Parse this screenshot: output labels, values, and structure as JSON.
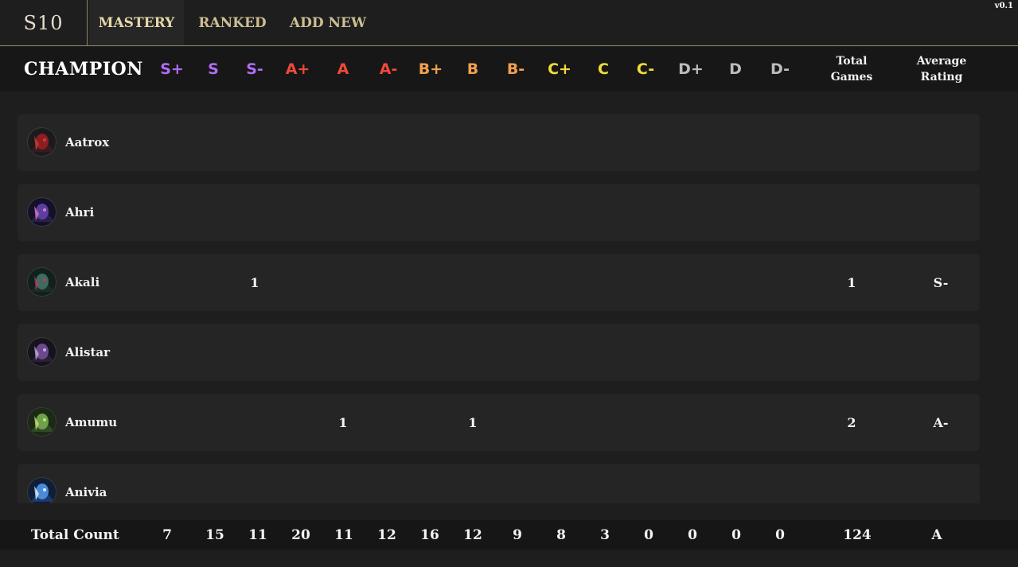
{
  "nav": {
    "season": "S10",
    "tabs": [
      {
        "label": "MASTERY"
      },
      {
        "label": "RANKED"
      },
      {
        "label": "ADD NEW"
      }
    ],
    "version": "v0.1"
  },
  "header": {
    "champion_label": "CHAMPION",
    "grades": [
      {
        "label": "S+",
        "color": "#b06cf5"
      },
      {
        "label": "S",
        "color": "#b06cf5"
      },
      {
        "label": "S-",
        "color": "#b06cf5"
      },
      {
        "label": "A+",
        "color": "#ee4a38"
      },
      {
        "label": "A",
        "color": "#ee4a38"
      },
      {
        "label": "A-",
        "color": "#ee4a38"
      },
      {
        "label": "B+",
        "color": "#f0a050"
      },
      {
        "label": "B",
        "color": "#f0a050"
      },
      {
        "label": "B-",
        "color": "#f0a050"
      },
      {
        "label": "C+",
        "color": "#f4dc3a"
      },
      {
        "label": "C",
        "color": "#f4dc3a"
      },
      {
        "label": "C-",
        "color": "#f4dc3a"
      },
      {
        "label": "D+",
        "color": "#bcbcbc"
      },
      {
        "label": "D",
        "color": "#bcbcbc"
      },
      {
        "label": "D-",
        "color": "#bcbcbc"
      }
    ],
    "total_games_line1": "Total",
    "total_games_line2": "Games",
    "average_rating_line1": "Average",
    "average_rating_line2": "Rating"
  },
  "champions": [
    {
      "name": "Aatrox",
      "icon": "aatrox-portrait",
      "counts": {},
      "total": "",
      "avg": ""
    },
    {
      "name": "Ahri",
      "icon": "ahri-portrait",
      "counts": {},
      "total": "",
      "avg": ""
    },
    {
      "name": "Akali",
      "icon": "akali-portrait",
      "counts": {
        "S-": "1"
      },
      "total": "1",
      "avg": "S-"
    },
    {
      "name": "Alistar",
      "icon": "alistar-portrait",
      "counts": {},
      "total": "",
      "avg": ""
    },
    {
      "name": "Amumu",
      "icon": "amumu-portrait",
      "counts": {
        "A": "1",
        "B": "1"
      },
      "total": "2",
      "avg": "A-"
    },
    {
      "name": "Anivia",
      "icon": "anivia-portrait",
      "counts": {},
      "total": "",
      "avg": ""
    }
  ],
  "footer": {
    "label": "Total Count",
    "values": [
      "7",
      "15",
      "11",
      "20",
      "11",
      "12",
      "16",
      "12",
      "9",
      "8",
      "3",
      "0",
      "0",
      "0",
      "0"
    ],
    "total_games": "124",
    "average": "A"
  }
}
